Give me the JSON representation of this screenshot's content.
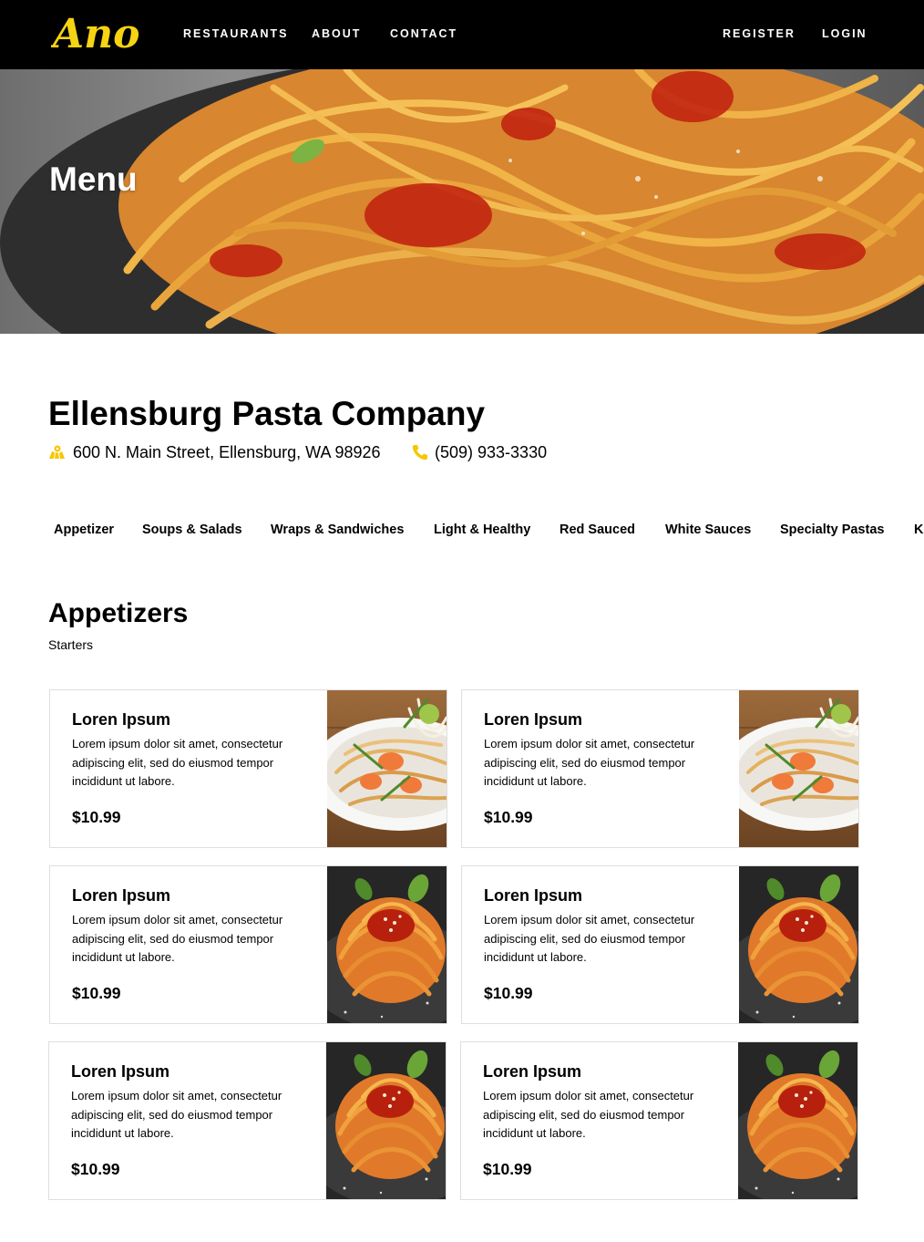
{
  "brand": {
    "logo_text": "Ano",
    "logo_color": "#f6d313"
  },
  "nav": {
    "left": [
      "RESTAURANTS",
      "ABOUT",
      "CONTACT"
    ],
    "right": [
      "REGISTER",
      "LOGIN"
    ]
  },
  "hero": {
    "title": "Menu"
  },
  "restaurant": {
    "name": "Ellensburg Pasta Company",
    "address": "600 N. Main Street, Ellensburg, WA 98926",
    "phone": "(509) 933-3330",
    "icon_color": "#f6c700"
  },
  "categories": [
    "Appetizer",
    "Soups & Salads",
    "Wraps & Sandwiches",
    "Light & Healthy",
    "Red Sauced",
    "White Sauces",
    "Specialty Pastas",
    "K"
  ],
  "section": {
    "title": "Appetizers",
    "subtitle": "Starters"
  },
  "items": [
    {
      "title": "Loren Ipsum",
      "description": "Lorem ipsum dolor sit amet, consectetur adipiscing elit, sed do eiusmod tempor incididunt ut labore.",
      "price": "$10.99",
      "image": "pad-thai-photo"
    },
    {
      "title": "Loren Ipsum",
      "description": "Lorem ipsum dolor sit amet, consectetur adipiscing elit, sed do eiusmod tempor incididunt ut labore.",
      "price": "$10.99",
      "image": "pad-thai-photo"
    },
    {
      "title": "Loren Ipsum",
      "description": "Lorem ipsum dolor sit amet, consectetur adipiscing elit, sed do eiusmod tempor incididunt ut labore.",
      "price": "$10.99",
      "image": "spaghetti-photo"
    },
    {
      "title": "Loren Ipsum",
      "description": "Lorem ipsum dolor sit amet, consectetur adipiscing elit, sed do eiusmod tempor incididunt ut labore.",
      "price": "$10.99",
      "image": "spaghetti-photo"
    },
    {
      "title": "Loren Ipsum",
      "description": "Lorem ipsum dolor sit amet, consectetur adipiscing elit, sed do eiusmod tempor incididunt ut labore.",
      "price": "$10.99",
      "image": "spaghetti-photo"
    },
    {
      "title": "Loren Ipsum",
      "description": "Lorem ipsum dolor sit amet, consectetur adipiscing elit, sed do eiusmod tempor incididunt ut labore.",
      "price": "$10.99",
      "image": "spaghetti-photo"
    }
  ]
}
